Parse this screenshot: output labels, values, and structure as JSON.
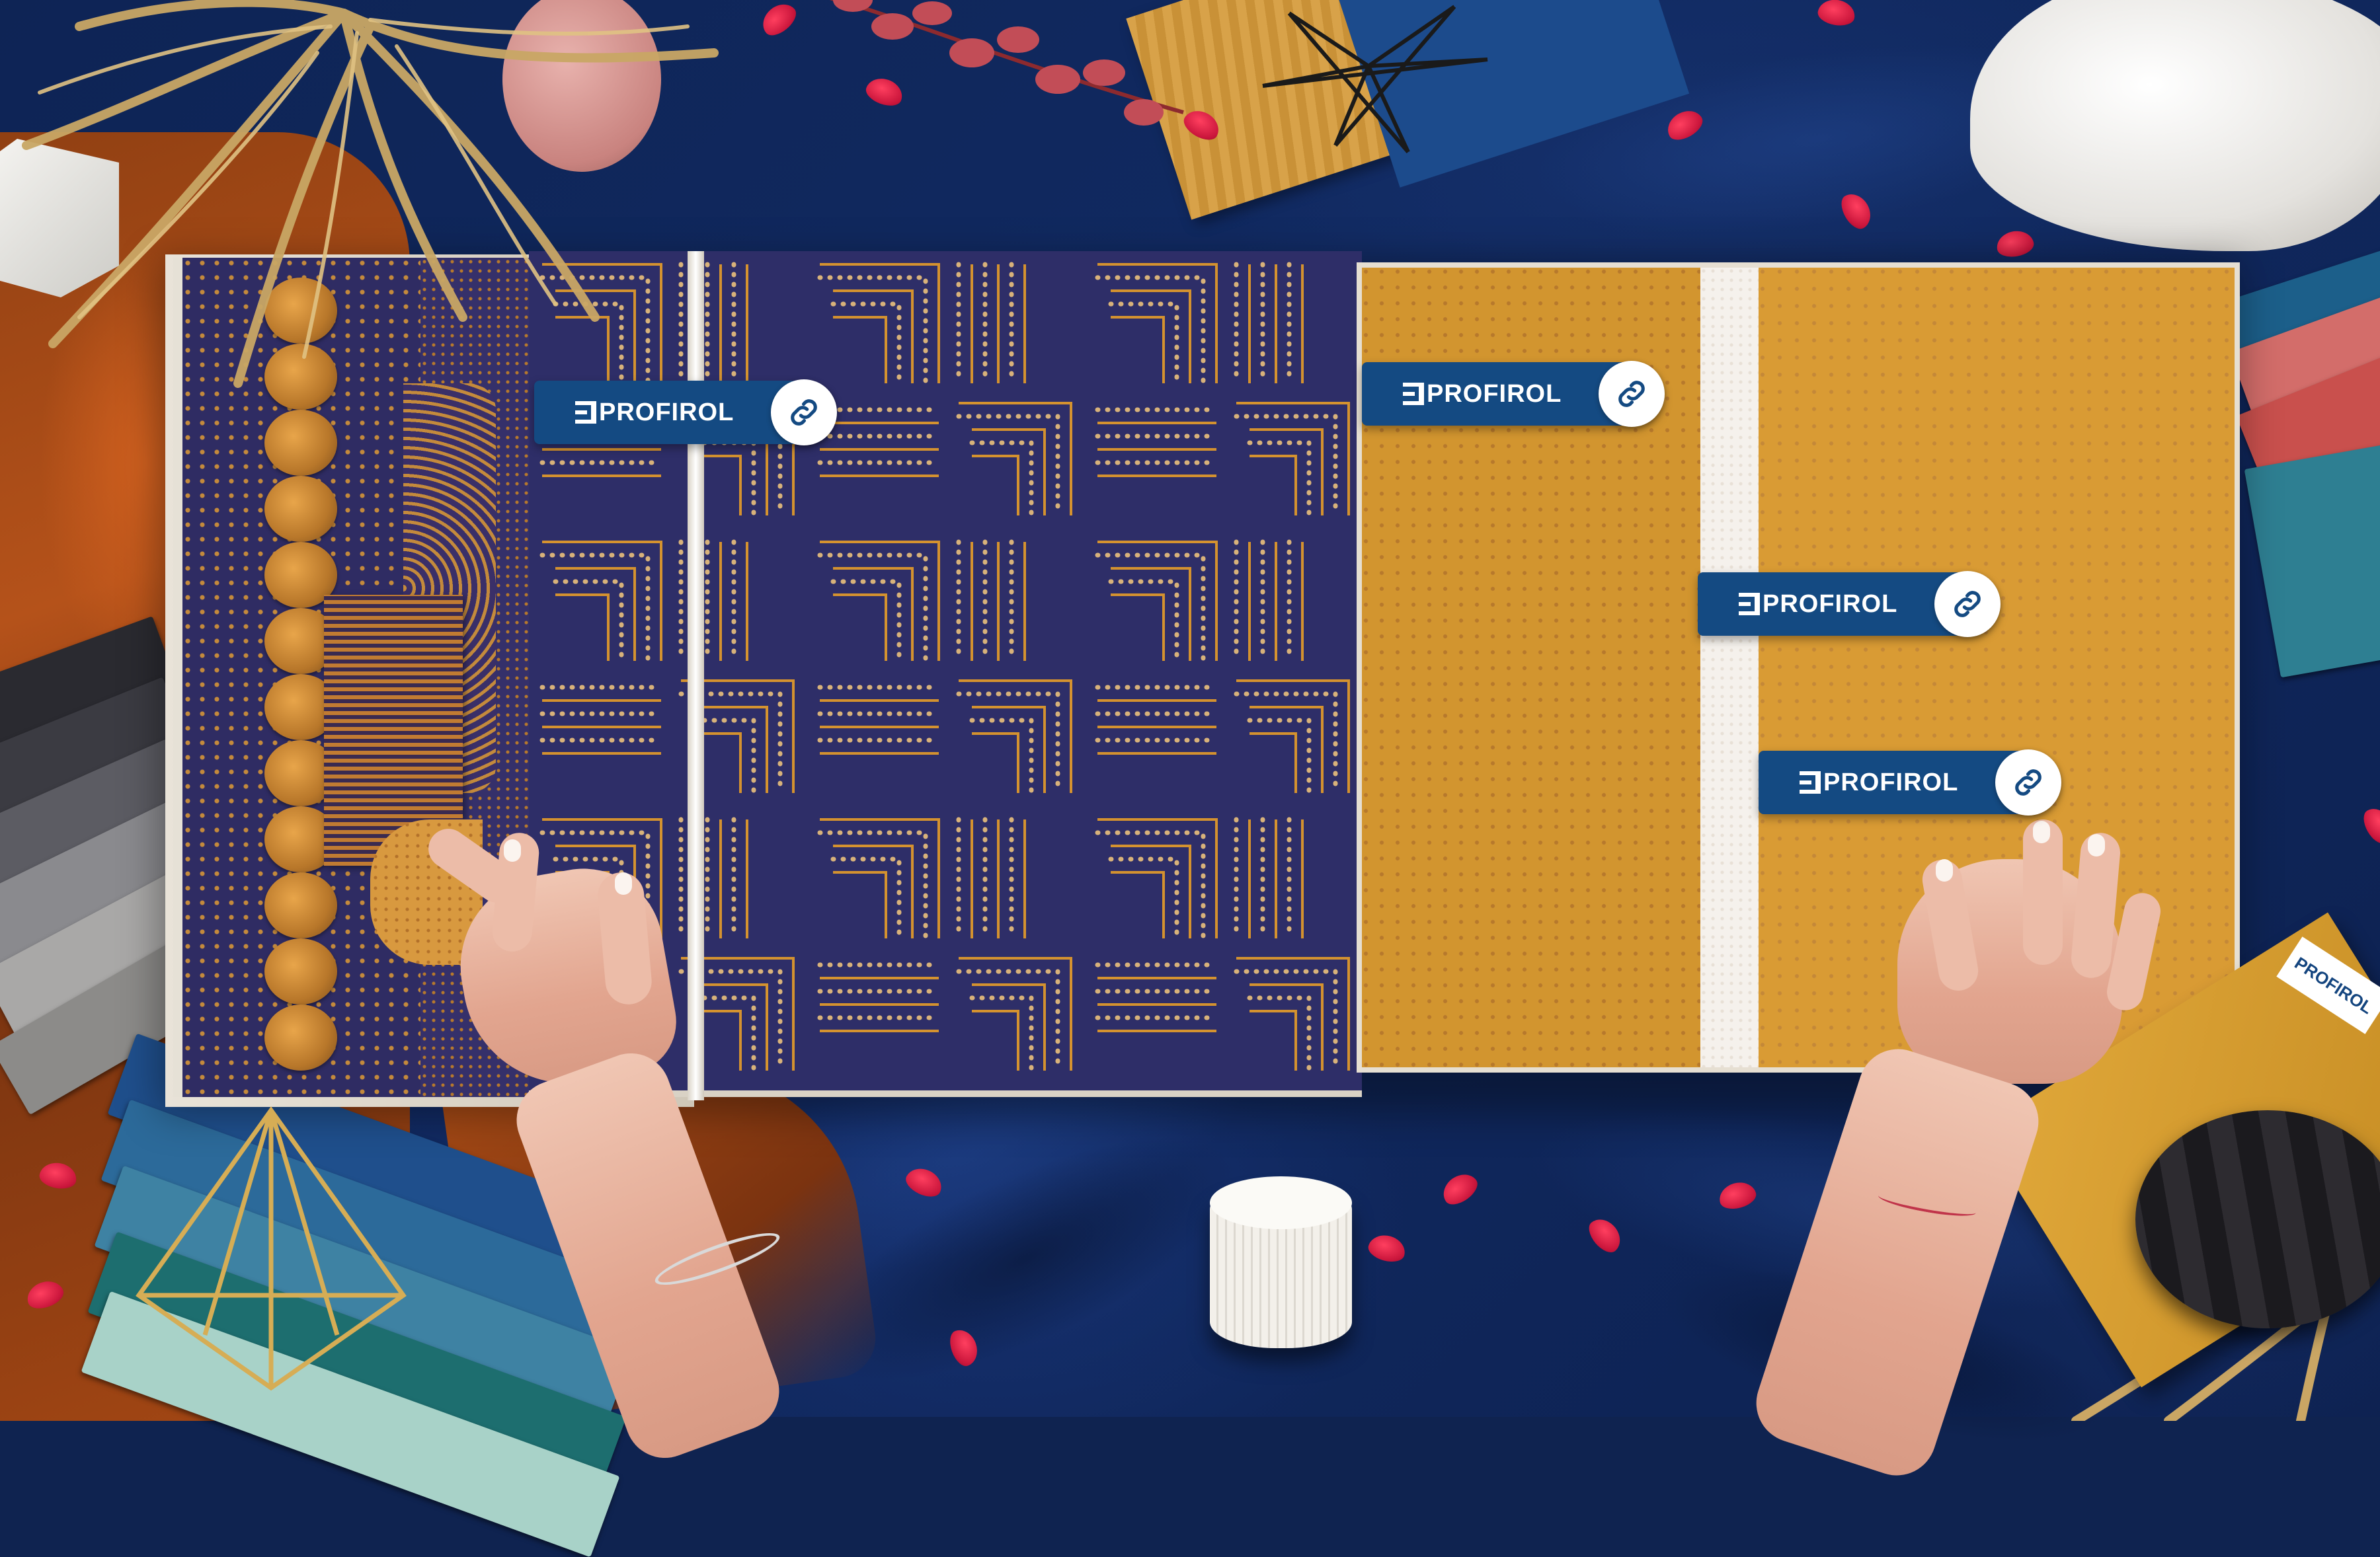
{
  "brand": {
    "name": "PROFIROL",
    "color": "#144a82"
  },
  "tags": [
    {
      "label": "PROFIROL",
      "icon": "link-icon"
    },
    {
      "label": "PROFIROL",
      "icon": "link-icon"
    },
    {
      "label": "PROFIROL",
      "icon": "link-icon"
    },
    {
      "label": "PROFIROL",
      "icon": "link-icon"
    }
  ],
  "card_logo": "PROFIROL",
  "palette": {
    "navy_cloth": "#112a62",
    "navy_wallpaper": "#2e2e68",
    "ochre_wallpaper": "#d2952f",
    "rust_velvet": "#b5521a",
    "petal_red": "#c9153b"
  }
}
